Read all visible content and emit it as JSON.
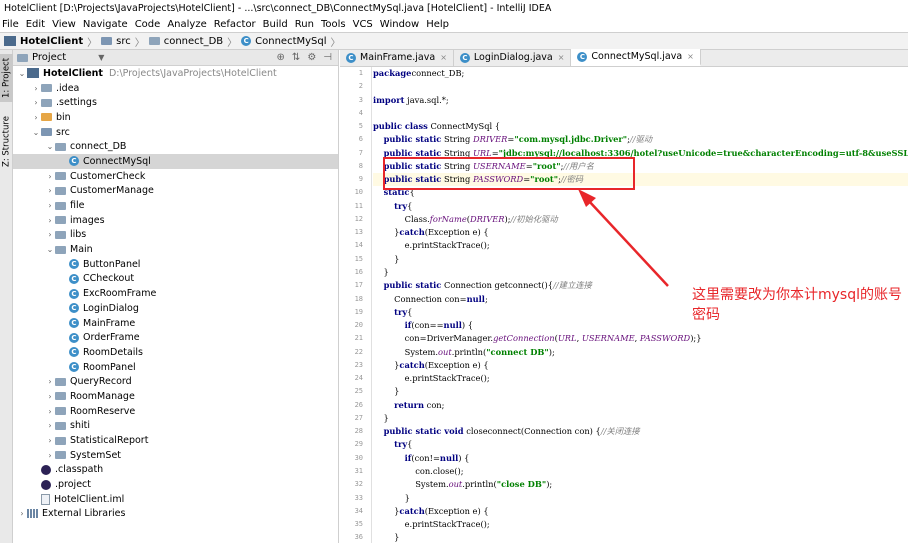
{
  "title": "HotelClient [D:\\Projects\\JavaProjects\\HotelClient] - ...\\src\\connect_DB\\ConnectMySql.java [HotelClient] - IntelliJ IDEA",
  "menu": [
    "File",
    "Edit",
    "View",
    "Navigate",
    "Code",
    "Analyze",
    "Refactor",
    "Build",
    "Run",
    "Tools",
    "VCS",
    "Window",
    "Help"
  ],
  "breadcrumb": [
    "HotelClient",
    "src",
    "connect_DB",
    "ConnectMySql"
  ],
  "side_tabs": {
    "project": "1: Project",
    "structure": "Z: Structure"
  },
  "project_panel": {
    "title": "Project"
  },
  "tree": [
    {
      "label": "HotelClient",
      "path": "D:\\Projects\\JavaProjects\\HotelClient",
      "depth": 0,
      "arrow": "down",
      "icon": "module",
      "bold": true
    },
    {
      "label": ".idea",
      "depth": 1,
      "arrow": "right",
      "icon": "folder"
    },
    {
      "label": ".settings",
      "depth": 1,
      "arrow": "right",
      "icon": "folder"
    },
    {
      "label": "bin",
      "depth": 1,
      "arrow": "right",
      "icon": "folder-orange"
    },
    {
      "label": "src",
      "depth": 1,
      "arrow": "down",
      "icon": "folder-src"
    },
    {
      "label": "connect_DB",
      "depth": 2,
      "arrow": "down",
      "icon": "folder"
    },
    {
      "label": "ConnectMySql",
      "depth": 3,
      "arrow": "",
      "icon": "class",
      "selected": true
    },
    {
      "label": "CustomerCheck",
      "depth": 2,
      "arrow": "right",
      "icon": "folder"
    },
    {
      "label": "CustomerManage",
      "depth": 2,
      "arrow": "right",
      "icon": "folder"
    },
    {
      "label": "file",
      "depth": 2,
      "arrow": "right",
      "icon": "folder"
    },
    {
      "label": "images",
      "depth": 2,
      "arrow": "right",
      "icon": "folder"
    },
    {
      "label": "libs",
      "depth": 2,
      "arrow": "right",
      "icon": "folder"
    },
    {
      "label": "Main",
      "depth": 2,
      "arrow": "down",
      "icon": "folder"
    },
    {
      "label": "ButtonPanel",
      "depth": 3,
      "arrow": "",
      "icon": "class"
    },
    {
      "label": "CCheckout",
      "depth": 3,
      "arrow": "",
      "icon": "class"
    },
    {
      "label": "ExcRoomFrame",
      "depth": 3,
      "arrow": "",
      "icon": "class"
    },
    {
      "label": "LoginDialog",
      "depth": 3,
      "arrow": "",
      "icon": "class"
    },
    {
      "label": "MainFrame",
      "depth": 3,
      "arrow": "",
      "icon": "class"
    },
    {
      "label": "OrderFrame",
      "depth": 3,
      "arrow": "",
      "icon": "class"
    },
    {
      "label": "RoomDetails",
      "depth": 3,
      "arrow": "",
      "icon": "class"
    },
    {
      "label": "RoomPanel",
      "depth": 3,
      "arrow": "",
      "icon": "class"
    },
    {
      "label": "QueryRecord",
      "depth": 2,
      "arrow": "right",
      "icon": "folder"
    },
    {
      "label": "RoomManage",
      "depth": 2,
      "arrow": "right",
      "icon": "folder"
    },
    {
      "label": "RoomReserve",
      "depth": 2,
      "arrow": "right",
      "icon": "folder"
    },
    {
      "label": "shiti",
      "depth": 2,
      "arrow": "right",
      "icon": "folder"
    },
    {
      "label": "StatisticalReport",
      "depth": 2,
      "arrow": "right",
      "icon": "folder"
    },
    {
      "label": "SystemSet",
      "depth": 2,
      "arrow": "right",
      "icon": "folder"
    },
    {
      "label": ".classpath",
      "depth": 1,
      "arrow": "",
      "icon": "eclipse"
    },
    {
      "label": ".project",
      "depth": 1,
      "arrow": "",
      "icon": "eclipse"
    },
    {
      "label": "HotelClient.iml",
      "depth": 1,
      "arrow": "",
      "icon": "file"
    },
    {
      "label": "External Libraries",
      "depth": 0,
      "arrow": "right",
      "icon": "libs"
    }
  ],
  "tabs": [
    {
      "label": "MainFrame.java",
      "active": false
    },
    {
      "label": "LoginDialog.java",
      "active": false
    },
    {
      "label": "ConnectMySql.java",
      "active": true
    }
  ],
  "line_numbers": [
    "1",
    "2",
    "3",
    "4",
    "5",
    "6",
    "7",
    "8",
    "9",
    "10",
    "11",
    "12",
    "13",
    "14",
    "15",
    "16",
    "17",
    "18",
    "19",
    "20",
    "21",
    "22",
    "23",
    "24",
    "25",
    "26",
    "27",
    "28",
    "29",
    "30",
    "31",
    "32",
    "33",
    "34",
    "35",
    "36"
  ],
  "code": [
    [
      [
        "kw",
        "package"
      ],
      [
        "",
        "connect_DB;"
      ]
    ],
    [],
    [
      [
        "kw",
        "import"
      ],
      [
        "",
        " java.sql.*;"
      ]
    ],
    [],
    [
      [
        "kw",
        "public class"
      ],
      [
        "",
        " ConnectMySql {"
      ]
    ],
    [
      [
        "",
        "    "
      ],
      [
        "kw",
        "public static"
      ],
      [
        "",
        " String "
      ],
      [
        "fd",
        "DRIVER"
      ],
      [
        "",
        "="
      ],
      [
        "st",
        "\"com.mysql.jdbc.Driver\""
      ],
      [
        "",
        ";"
      ],
      [
        "cm",
        "//驱动"
      ]
    ],
    [
      [
        "",
        "    "
      ],
      [
        "kw",
        "public static"
      ],
      [
        "",
        " String "
      ],
      [
        "fd",
        "URL"
      ],
      [
        "",
        "="
      ],
      [
        "st",
        "\"jdbc:mysql://localhost:3306/hotel?useUnicode=true&characterEncoding=utf-8&useSSL"
      ]
    ],
    [
      [
        "",
        "    "
      ],
      [
        "kw",
        "public static"
      ],
      [
        "",
        " String "
      ],
      [
        "fd",
        "USERNAME"
      ],
      [
        "",
        "="
      ],
      [
        "st",
        "\"root\""
      ],
      [
        "",
        ";"
      ],
      [
        "cm",
        "//用户名"
      ]
    ],
    [
      [
        "",
        "    "
      ],
      [
        "kw",
        "public static"
      ],
      [
        "",
        " String "
      ],
      [
        "fd",
        "PASSWORD"
      ],
      [
        "",
        "="
      ],
      [
        "st",
        "\"root\""
      ],
      [
        "",
        ";"
      ],
      [
        "cm",
        "//密码"
      ]
    ],
    [
      [
        "",
        "    "
      ],
      [
        "kw",
        "static"
      ],
      [
        "",
        "{"
      ]
    ],
    [
      [
        "",
        "        "
      ],
      [
        "kw",
        "try"
      ],
      [
        "",
        "{"
      ]
    ],
    [
      [
        "",
        "            Class."
      ],
      [
        "fd",
        "forName"
      ],
      [
        "",
        "("
      ],
      [
        "fd",
        "DRIVER"
      ],
      [
        "",
        ");"
      ],
      [
        "cm",
        "//初始化驱动"
      ]
    ],
    [
      [
        "",
        "        }"
      ],
      [
        "kw",
        "catch"
      ],
      [
        "",
        "(Exception e) {"
      ]
    ],
    [
      [
        "",
        "            e.printStackTrace();"
      ]
    ],
    [
      [
        "",
        "        }"
      ]
    ],
    [
      [
        "",
        "    }"
      ]
    ],
    [
      [
        "",
        "    "
      ],
      [
        "kw",
        "public static"
      ],
      [
        "",
        " Connection getconnect(){"
      ],
      [
        "cm",
        "//建立连接"
      ]
    ],
    [
      [
        "",
        "        Connection con="
      ],
      [
        "kw",
        "null"
      ],
      [
        "",
        ";"
      ]
    ],
    [
      [
        "",
        "        "
      ],
      [
        "kw",
        "try"
      ],
      [
        "",
        "{"
      ]
    ],
    [
      [
        "",
        "            "
      ],
      [
        "kw",
        "if"
      ],
      [
        "",
        "(con=="
      ],
      [
        "kw",
        "null"
      ],
      [
        "",
        ") {"
      ]
    ],
    [
      [
        "",
        "            con=DriverManager."
      ],
      [
        "fd",
        "getConnection"
      ],
      [
        "",
        "("
      ],
      [
        "fd",
        "URL"
      ],
      [
        "",
        ", "
      ],
      [
        "fd",
        "USERNAME"
      ],
      [
        "",
        ", "
      ],
      [
        "fd",
        "PASSWORD"
      ],
      [
        "",
        ");}"
      ]
    ],
    [
      [
        "",
        "            System."
      ],
      [
        "fd",
        "out"
      ],
      [
        "",
        ".println("
      ],
      [
        "st",
        "\"connect DB\""
      ],
      [
        "",
        ");"
      ]
    ],
    [
      [
        "",
        "        }"
      ],
      [
        "kw",
        "catch"
      ],
      [
        "",
        "(Exception e) {"
      ]
    ],
    [
      [
        "",
        "            e.printStackTrace();"
      ]
    ],
    [
      [
        "",
        "        }"
      ]
    ],
    [
      [
        "",
        "        "
      ],
      [
        "kw",
        "return"
      ],
      [
        "",
        " con;"
      ]
    ],
    [
      [
        "",
        "    }"
      ]
    ],
    [
      [
        "",
        "    "
      ],
      [
        "kw",
        "public static void"
      ],
      [
        "",
        " closeconnect(Connection con) {"
      ],
      [
        "cm",
        "//关闭连接"
      ]
    ],
    [
      [
        "",
        "        "
      ],
      [
        "kw",
        "try"
      ],
      [
        "",
        "{"
      ]
    ],
    [
      [
        "",
        "            "
      ],
      [
        "kw",
        "if"
      ],
      [
        "",
        "(con!="
      ],
      [
        "kw",
        "null"
      ],
      [
        "",
        ") {"
      ]
    ],
    [
      [
        "",
        "                con.close();"
      ]
    ],
    [
      [
        "",
        "                System."
      ],
      [
        "fd",
        "out"
      ],
      [
        "",
        ".println("
      ],
      [
        "st",
        "\"close DB\""
      ],
      [
        "",
        ");"
      ]
    ],
    [
      [
        "",
        "            }"
      ]
    ],
    [
      [
        "",
        "        }"
      ],
      [
        "kw",
        "catch"
      ],
      [
        "",
        "(Exception e) {"
      ]
    ],
    [
      [
        "",
        "            e.printStackTrace();"
      ]
    ],
    [
      [
        "",
        "        }"
      ]
    ]
  ],
  "annotation": "这里需要改为你本计mysql的账号密码",
  "colors": {
    "annotation": "#e8262a",
    "keyword": "#000080",
    "string": "#008000",
    "field": "#660e7a",
    "comment": "#808080"
  }
}
